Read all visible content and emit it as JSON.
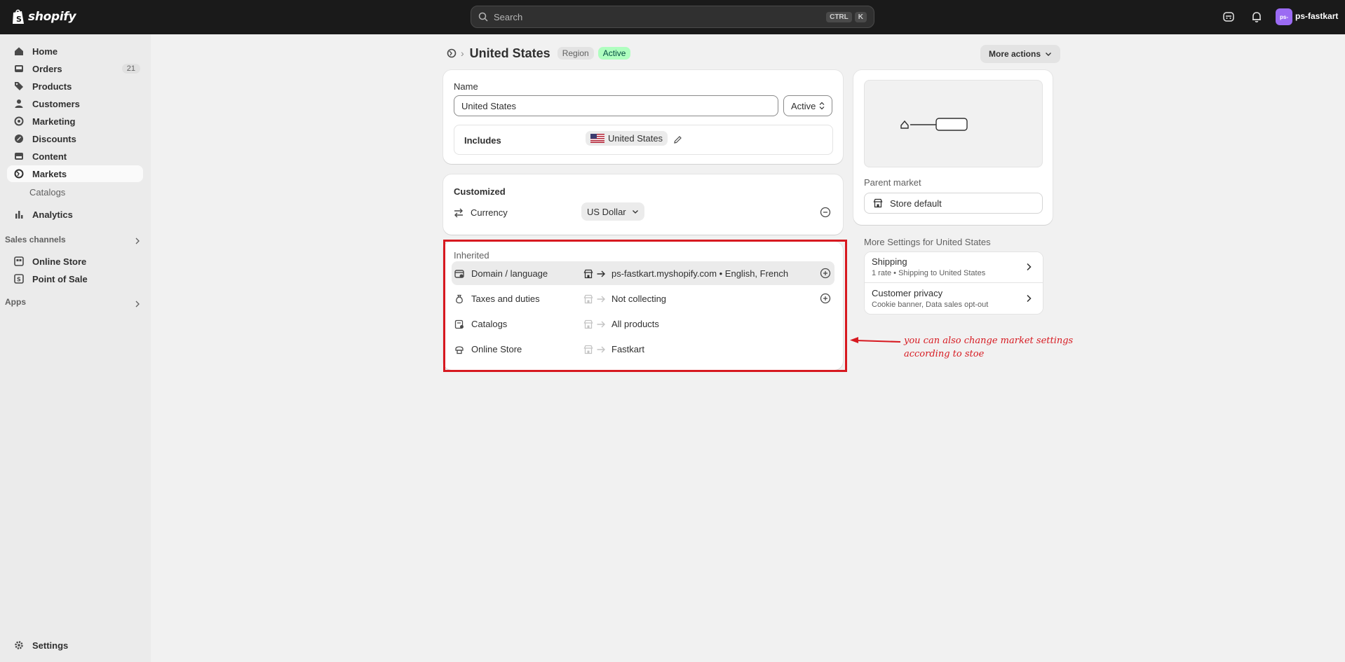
{
  "topbar": {
    "logo_text": "shopify",
    "search_placeholder": "Search",
    "shortcut_key1": "CTRL",
    "shortcut_key2": "K",
    "avatar_initials": "ps-",
    "store_name": "ps-fastkart"
  },
  "sidebar": {
    "items": [
      {
        "label": "Home",
        "icon": "home-icon"
      },
      {
        "label": "Orders",
        "icon": "orders-icon",
        "count": "21"
      },
      {
        "label": "Products",
        "icon": "tag-icon"
      },
      {
        "label": "Customers",
        "icon": "person-icon"
      },
      {
        "label": "Marketing",
        "icon": "target-icon"
      },
      {
        "label": "Discounts",
        "icon": "discount-icon"
      },
      {
        "label": "Content",
        "icon": "content-icon"
      },
      {
        "label": "Markets",
        "icon": "globe-icon"
      }
    ],
    "sub_catalogs": "Catalogs",
    "analytics": "Analytics",
    "sales_channels_heading": "Sales channels",
    "online_store": "Online Store",
    "point_of_sale": "Point of Sale",
    "apps_heading": "Apps",
    "settings": "Settings"
  },
  "page": {
    "title": "United States",
    "badge_region": "Region",
    "badge_active": "Active",
    "more_actions": "More actions"
  },
  "name_card": {
    "name_label": "Name",
    "name_value": "United States",
    "status_value": "Active",
    "includes_label": "Includes",
    "includes_tag": "United States"
  },
  "customized_card": {
    "heading": "Customized",
    "currency_label": "Currency",
    "currency_value": "US Dollar"
  },
  "inherited_card": {
    "heading": "Inherited",
    "rows": [
      {
        "label": "Domain / language",
        "value": "ps-fastkart.myshopify.com • English, French"
      },
      {
        "label": "Taxes and duties",
        "value": "Not collecting"
      },
      {
        "label": "Catalogs",
        "value": "All products"
      },
      {
        "label": "Online Store",
        "value": "Fastkart"
      }
    ]
  },
  "side_card": {
    "parent_market_label": "Parent market",
    "parent_market_value": "Store default"
  },
  "more_settings": {
    "heading": "More Settings for United States",
    "items": [
      {
        "title": "Shipping",
        "subtitle": "1 rate • Shipping to United States"
      },
      {
        "title": "Customer privacy",
        "subtitle": "Cookie banner, Data sales opt-out"
      }
    ]
  },
  "annotation": {
    "line1": "you can also change market settings",
    "line2": "according to stoe"
  },
  "colors": {
    "topbar_bg": "#1a1a1a",
    "sidebar_bg": "#ebebeb",
    "active_badge_bg": "#affebf",
    "annotation_red": "#d71920",
    "avatar_bg": "#9b6bf3"
  }
}
